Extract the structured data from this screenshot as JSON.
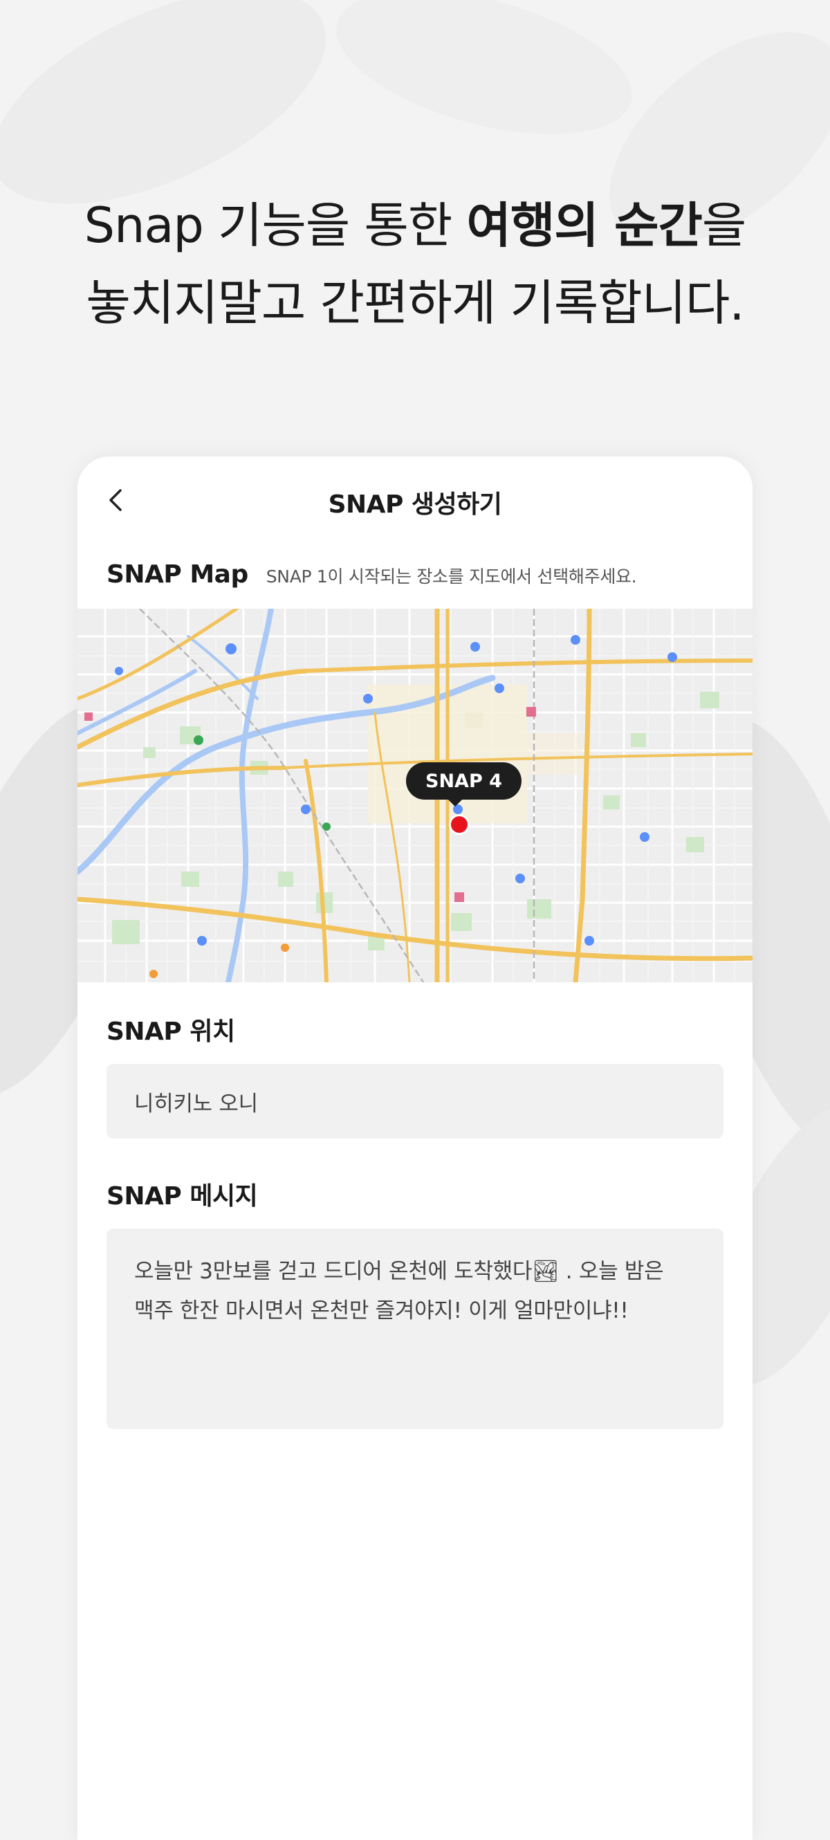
{
  "headline": {
    "line1_prefix": "Snap 기능을 통한 ",
    "line1_bold": "여행의 순간",
    "line1_suffix": "을",
    "line2": "놓치지말고 간편하게 기록합니다."
  },
  "screen": {
    "title": "SNAP 생성하기",
    "back_icon": "chevron-left-icon"
  },
  "map_section": {
    "label": "SNAP Map",
    "hint": "SNAP 1이 시작되는 장소를 지도에서 선택해주세요.",
    "marker_label": "SNAP 4",
    "marker_color": "#e8141c"
  },
  "location_section": {
    "label": "SNAP 위치",
    "value": "니히키노 오니"
  },
  "message_section": {
    "label": "SNAP 메시지",
    "value": "오늘만 3만보를 걷고 드디어 온천에 도착했다🏞 . 오늘 밤은\n맥주 한잔 마시면서 온천만 즐겨야지! 이게 얼마만이냐!!"
  }
}
